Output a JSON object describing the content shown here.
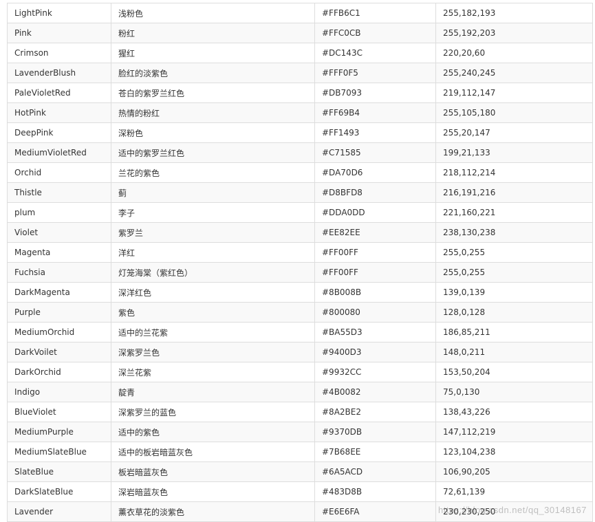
{
  "colors": {
    "border": "#dddddd",
    "stripe": "#f9f9f9",
    "text": "#333333"
  },
  "rows": [
    [
      "LightPink",
      "浅粉色",
      "#FFB6C1",
      "255,182,193"
    ],
    [
      "Pink",
      "粉红",
      "#FFC0CB",
      "255,192,203"
    ],
    [
      "Crimson",
      "猩红",
      "#DC143C",
      "220,20,60"
    ],
    [
      "LavenderBlush",
      "脸红的淡紫色",
      "#FFF0F5",
      "255,240,245"
    ],
    [
      "PaleVioletRed",
      "苍白的紫罗兰红色",
      "#DB7093",
      "219,112,147"
    ],
    [
      "HotPink",
      "热情的粉红",
      "#FF69B4",
      "255,105,180"
    ],
    [
      "DeepPink",
      "深粉色",
      "#FF1493",
      "255,20,147"
    ],
    [
      "MediumVioletRed",
      "适中的紫罗兰红色",
      "#C71585",
      "199,21,133"
    ],
    [
      "Orchid",
      "兰花的紫色",
      "#DA70D6",
      "218,112,214"
    ],
    [
      "Thistle",
      "蓟",
      "#D8BFD8",
      "216,191,216"
    ],
    [
      "plum",
      "李子",
      "#DDA0DD",
      "221,160,221"
    ],
    [
      "Violet",
      "紫罗兰",
      "#EE82EE",
      "238,130,238"
    ],
    [
      "Magenta",
      "洋红",
      "#FF00FF",
      "255,0,255"
    ],
    [
      "Fuchsia",
      "灯笼海棠（紫红色）",
      "#FF00FF",
      "255,0,255"
    ],
    [
      "DarkMagenta",
      "深洋红色",
      "#8B008B",
      "139,0,139"
    ],
    [
      "Purple",
      "紫色",
      "#800080",
      "128,0,128"
    ],
    [
      "MediumOrchid",
      "适中的兰花紫",
      "#BA55D3",
      "186,85,211"
    ],
    [
      "DarkVoilet",
      "深紫罗兰色",
      "#9400D3",
      "148,0,211"
    ],
    [
      "DarkOrchid",
      "深兰花紫",
      "#9932CC",
      "153,50,204"
    ],
    [
      "Indigo",
      "靛青",
      "#4B0082",
      "75,0,130"
    ],
    [
      "BlueViolet",
      "深紫罗兰的蓝色",
      "#8A2BE2",
      "138,43,226"
    ],
    [
      "MediumPurple",
      "适中的紫色",
      "#9370DB",
      "147,112,219"
    ],
    [
      "MediumSlateBlue",
      "适中的板岩暗蓝灰色",
      "#7B68EE",
      "123,104,238"
    ],
    [
      "SlateBlue",
      "板岩暗蓝灰色",
      "#6A5ACD",
      "106,90,205"
    ],
    [
      "DarkSlateBlue",
      "深岩暗蓝灰色",
      "#483D8B",
      "72,61,139"
    ],
    [
      "Lavender",
      "薰衣草花的淡紫色",
      "#E6E6FA",
      "230,230,250"
    ]
  ],
  "watermark": "https://blog.csdn.net/qq_30148167"
}
